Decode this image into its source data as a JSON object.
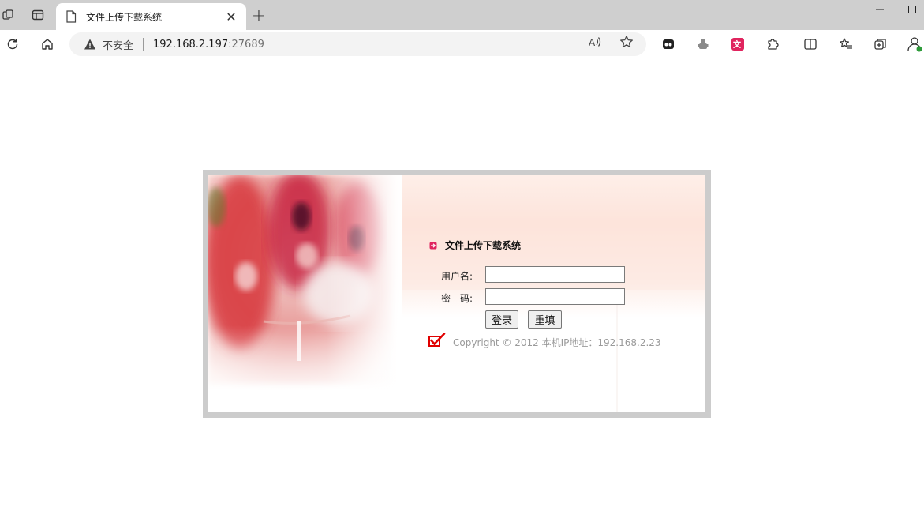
{
  "browser": {
    "tab": {
      "title": "文件上传下载系统",
      "close_glyph": "✕"
    },
    "new_tab_glyph": "+",
    "window": {
      "minimize_glyph": "—",
      "maximize_glyph": "☐"
    },
    "address": {
      "security_label": "不安全",
      "host": "192.168.2.197",
      "port": ":27689"
    },
    "icons": [
      "workspaces-icon",
      "tab-actions-icon",
      "page-icon",
      "back-icon",
      "refresh-icon",
      "home-icon",
      "warning-icon",
      "read-aloud-icon",
      "favorite-star-icon",
      "extension-1-icon",
      "extension-2-icon",
      "translate-extension-icon",
      "extensions-icon",
      "split-screen-icon",
      "favorites-icon",
      "collections-icon",
      "profile-icon"
    ]
  },
  "login": {
    "title": "文件上传下载系统",
    "username_label": "用户名:",
    "username_value": "",
    "password_label": "密　码:",
    "password_value": "",
    "login_button": "登录",
    "reset_button": "重填",
    "copyright": "Copyright © 2012 本机IP地址：192.168.2.23"
  },
  "colors": {
    "frame": "#cccccc",
    "accent_pink": "#e0245e",
    "check_red": "#e00000",
    "copyright_gray": "#9a9a9a"
  }
}
